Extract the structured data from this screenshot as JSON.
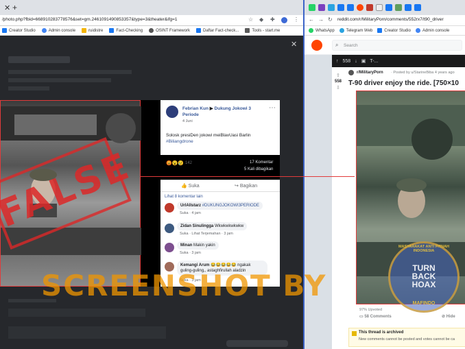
{
  "left": {
    "url": "/photo.php?fbid=668910283778576&set=gm.2461091490853357&type=3&theater&ifg=1",
    "bookmarks": [
      {
        "label": "Creator Studio",
        "color": "#1877f2"
      },
      {
        "label": "Admin console",
        "color": "#4285f4"
      },
      {
        "label": "ruidistre",
        "color": "#f4b400"
      },
      {
        "label": "Fact-Checking",
        "color": "#1877f2"
      },
      {
        "label": "OSINT Framework",
        "color": "#555555"
      },
      {
        "label": "Daftar Fact-check...",
        "color": "#1877f2"
      },
      {
        "label": "Tools - start.me",
        "color": "#5a5a5a"
      }
    ],
    "post": {
      "author": "Febrian Kun",
      "arrow": "▶",
      "group": "Dukung Jokowi 3 Periode",
      "time": "4 Juni",
      "text": "Solosk presiDen jokowi meiBlavUasi Barlin",
      "hashtag": "#Biliangdrone",
      "reaction_count": "142",
      "comments_count": "17 Komentar",
      "shares_count": "5 Kali dibagikan",
      "like_label": "Suka",
      "share_label": "Bagikan",
      "more_comments": "Lihat 8 komentar lain",
      "comments": [
        {
          "name": "UrlAllstarz",
          "text": "#DUKUNGJOKOWI3PERIODE",
          "meta": "Suka · 4 jam"
        },
        {
          "name": "Zidan Sinulingga",
          "text": "Wkwkwkwkwkw",
          "meta": "Suka · Lihat Terjemahan · 3 jam"
        },
        {
          "name": "Minan",
          "text": "Makin yakin",
          "meta": "Suka · 3 jam"
        },
        {
          "name": "Kemangi Arum",
          "text": "😂😂😂😂😂 ngakak guling-guling,, astaghfirullah aladzin",
          "meta": "Suka · 3 jam"
        }
      ]
    },
    "stamp": "FALSE"
  },
  "right": {
    "bookmarks": [
      {
        "label": "WhatsApp",
        "color": "#25d366"
      },
      {
        "label": "Telegram Web",
        "color": "#2aa3e0"
      },
      {
        "label": "Creator Studio",
        "color": "#1877f2"
      },
      {
        "label": "Admin console",
        "color": "#4285f4"
      }
    ],
    "url": "reddit.com/r/MilitaryPorn/comments/552rx7/t90_driver",
    "search_placeholder": "Search",
    "vote_count": "558",
    "dark_title": "T-...",
    "subreddit": "r/MilitaryPorn",
    "posted_by": "· Posted by u/StarineBiba 4 years ago",
    "title": "T-90 driver enjoy the ride. [750×10",
    "upvoted": "97% Upvoted",
    "comments_label": "58 Comments",
    "hide_label": "Hide",
    "archived_title": "This thread is archived",
    "archived_text": "New comments cannot be posted and votes cannot be ca"
  },
  "watermark": "SCREENSHOT BY",
  "badge": {
    "ring": "MASYARAKAT ANTI FITNAH INDONESIA",
    "line1": "TURN",
    "line2": "BACK",
    "line3": "HOAX",
    "bottom": "MAFINDO"
  }
}
